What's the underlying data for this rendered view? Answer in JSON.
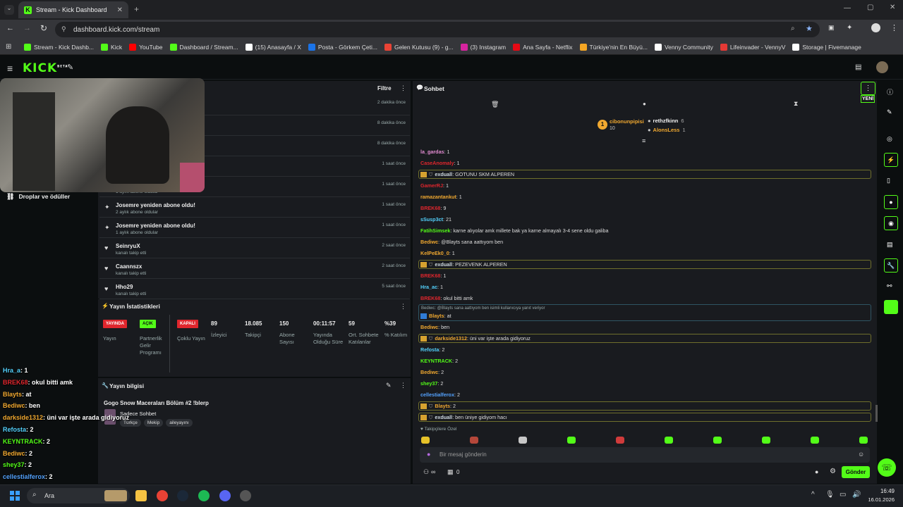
{
  "browser": {
    "tab_title": "Stream - Kick Dashboard",
    "url": "dashboard.kick.com/stream",
    "bookmarks": [
      {
        "label": "Stream - Kick Dashb...",
        "color": "#53fc18"
      },
      {
        "label": "Kick",
        "color": "#53fc18"
      },
      {
        "label": "YouTube",
        "color": "#ff0000"
      },
      {
        "label": "Dashboard / Stream...",
        "color": "#53fc18"
      },
      {
        "label": "(15) Anasayfa / X",
        "color": "#ffffff"
      },
      {
        "label": "Posta - Görkem Çeti...",
        "color": "#1a73e8"
      },
      {
        "label": "Gelen Kutusu (9) - g...",
        "color": "#ea4335"
      },
      {
        "label": "(3) Instagram",
        "color": "#d6249f"
      },
      {
        "label": "Ana Sayfa - Netflix",
        "color": "#e50914"
      },
      {
        "label": "Türkiye'nin En Büyü...",
        "color": "#f5a623"
      },
      {
        "label": "Venny Community",
        "color": "#ffffff"
      },
      {
        "label": "Lifeinvader - VennyV",
        "color": "#e53935"
      },
      {
        "label": "Storage | Fivemanage",
        "color": "#ffffff"
      }
    ]
  },
  "kick": {
    "logo": "KICK",
    "logo_sup": "BETA"
  },
  "activity": {
    "filter_label": "Filtre",
    "sidebar_item": "Droplar ve ödüller",
    "rows": [
      {
        "title": "",
        "sub": "",
        "time": "2 dakika önce"
      },
      {
        "title": "",
        "sub": "",
        "time": "8 dakika önce"
      },
      {
        "title": "",
        "sub": "",
        "time": "8 dakika önce"
      },
      {
        "title": "",
        "sub": "",
        "time": "1 saat önce"
      },
      {
        "title": "",
        "sub": "1 aylık abone oldular",
        "time": "1 saat önce"
      },
      {
        "title": "Josemre yeniden abone oldu!",
        "sub": "2 aylık abone oldular",
        "time": "1 saat önce",
        "icon": "star"
      },
      {
        "title": "Josemre yeniden abone oldu!",
        "sub": "1 aylık abone oldular",
        "time": "1 saat önce",
        "icon": "star"
      },
      {
        "title": "SeinryuX",
        "sub": "kanalı takip etti",
        "time": "2 saat önce",
        "icon": "heart"
      },
      {
        "title": "Caannszx",
        "sub": "kanalı takip etti",
        "time": "2 saat önce",
        "icon": "heart"
      },
      {
        "title": "Hho29",
        "sub": "kanalı takip etti",
        "time": "5 saat önce",
        "icon": "heart"
      }
    ]
  },
  "stats": {
    "title": "Yayın İstatistikleri",
    "badges": [
      {
        "text": "YAYINDA",
        "label": "Yayın",
        "color": "#e0262d",
        "fg": "#ffffff"
      },
      {
        "text": "AÇIK",
        "label": "Partnerlik Gelir Programı",
        "color": "#53fc18",
        "fg": "#0b0e0f"
      },
      {
        "text": "KAPALI",
        "label": "Çoklu Yayın",
        "color": "#e0262d",
        "fg": "#ffffff"
      }
    ],
    "values": [
      {
        "value": "89",
        "label": "İzleyici"
      },
      {
        "value": "18.085",
        "label": "Takipçi"
      },
      {
        "value": "150",
        "label": "Abone Sayısı"
      },
      {
        "value": "00:11:57",
        "label": "Yayında Olduğu Süre"
      },
      {
        "value": "59",
        "label": "Ort. Sohbete Katılanlar"
      },
      {
        "value": "%39",
        "label": "% Katılım"
      }
    ]
  },
  "info": {
    "title": "Yayın bilgisi",
    "stream_title": "Gogo Snow Maceraları Bölüm #2 !blerp",
    "category": "Sadece Sohbet",
    "tags": [
      "Türkçe",
      "Mekip",
      "aileyayını"
    ]
  },
  "chat": {
    "title": "Sohbet",
    "new_label": "YENİ",
    "top_gifter": {
      "name": "cibonunpipisi",
      "count": "10"
    },
    "gifters": [
      {
        "name": "rethzfkinn",
        "count": "6"
      },
      {
        "name": "AlonsLess",
        "count": "1"
      }
    ],
    "messages": [
      {
        "user": "la_gardas",
        "color": "#e08bd0",
        "text": ": 1"
      },
      {
        "user": "CaseAnomaly",
        "color": "#e0262d",
        "text": ": 1"
      },
      {
        "user": "exduall",
        "color": "#cfd9e0",
        "text": ": GOTUNU SKM ALPEREN",
        "hl": true
      },
      {
        "user": "GamerRJ",
        "color": "#e0262d",
        "text": ": 1"
      },
      {
        "user": "ramazantankut",
        "color": "#f0a830",
        "text": ": 1"
      },
      {
        "user": "BREK68",
        "color": "#e0262d",
        "text": ": 9"
      },
      {
        "user": "sSusp3ct",
        "color": "#53d1fc",
        "text": ": 21"
      },
      {
        "user": "FatihSimsek",
        "color": "#53fc18",
        "text": ": karne alıyolar amk millete bak ya karne almayalı 3-4 sene oldu galiba"
      },
      {
        "user": "Bediwc",
        "color": "#f0a830",
        "text": ": @Blayts sana aattıyom ben"
      },
      {
        "user": "KelPeEk0_0",
        "color": "#f0a830",
        "text": ": 1"
      },
      {
        "user": "exduall",
        "color": "#cfd9e0",
        "text": ": PEZEVENK ALPEREN",
        "hl": true
      },
      {
        "user": "BREK68",
        "color": "#e0262d",
        "text": ": 1"
      },
      {
        "user": "Hra_ac",
        "color": "#53d1fc",
        "text": ": 1"
      },
      {
        "user": "BREK68",
        "color": "#e0262d",
        "text": ": okul bitti amk"
      }
    ],
    "reply_note": "Bediwc: @Blayts sana aattıyom ben isimli kullanıcıya yanıt veriyor",
    "reply_msg": {
      "user": "Blayts",
      "color": "#f0a830",
      "text": ": at"
    },
    "messages2": [
      {
        "user": "Bediwc",
        "color": "#f0a830",
        "text": ": ben"
      },
      {
        "user": "darkside1312",
        "color": "#f0a830",
        "text": ": üni var işte arada gidiyoruz",
        "hl": true
      },
      {
        "user": "Refosta",
        "color": "#53d1fc",
        "text": ": 2"
      },
      {
        "user": "KEYNTRACK",
        "color": "#53fc18",
        "text": ": 2"
      },
      {
        "user": "Bediwc",
        "color": "#f0a830",
        "text": ": 2"
      },
      {
        "user": "shey37",
        "color": "#53fc18",
        "text": ": 2"
      },
      {
        "user": "cellestialferox",
        "color": "#53a1fc",
        "text": ": 2"
      },
      {
        "user": "Blayts",
        "color": "#f0a830",
        "text": ": 2",
        "hl": true
      },
      {
        "user": "exduall",
        "color": "#cfd9e0",
        "text": ": ben üniye gidiyom hacı",
        "hl": true
      }
    ],
    "followers_only": "Takipçilere Özel",
    "input_placeholder": "Bir mesaj gönderin",
    "points": "∞",
    "store_count": "0",
    "send_label": "Gönder"
  },
  "overlay": [
    {
      "user": "Hra_a",
      "color": "#53d1fc",
      "text": ": 1"
    },
    {
      "user": "BREK68",
      "color": "#e0262d",
      "text": ": okul bitti amk"
    },
    {
      "user": "Blayts",
      "color": "#f0a830",
      "text": ": at"
    },
    {
      "user": "Bediwc",
      "color": "#f0a830",
      "text": ": ben"
    },
    {
      "user": "darkside1312",
      "color": "#f0a830",
      "text": ": üni var işte arada gidiyoruz"
    },
    {
      "user": "Refosta",
      "color": "#53d1fc",
      "text": ": 2"
    },
    {
      "user": "KEYNTRACK",
      "color": "#53fc18",
      "text": ": 2"
    },
    {
      "user": "Bediwc",
      "color": "#f0a830",
      "text": ": 2"
    },
    {
      "user": "shey37",
      "color": "#53fc18",
      "text": ": 2"
    },
    {
      "user": "cellestialferox",
      "color": "#53a1fc",
      "text": ": 2"
    },
    {
      "user": "Blayts",
      "color": "#f0a830",
      "text": ": 2"
    }
  ],
  "taskbar": {
    "search_label": "Ara",
    "time": "16:49",
    "date": "16.01.2026"
  }
}
